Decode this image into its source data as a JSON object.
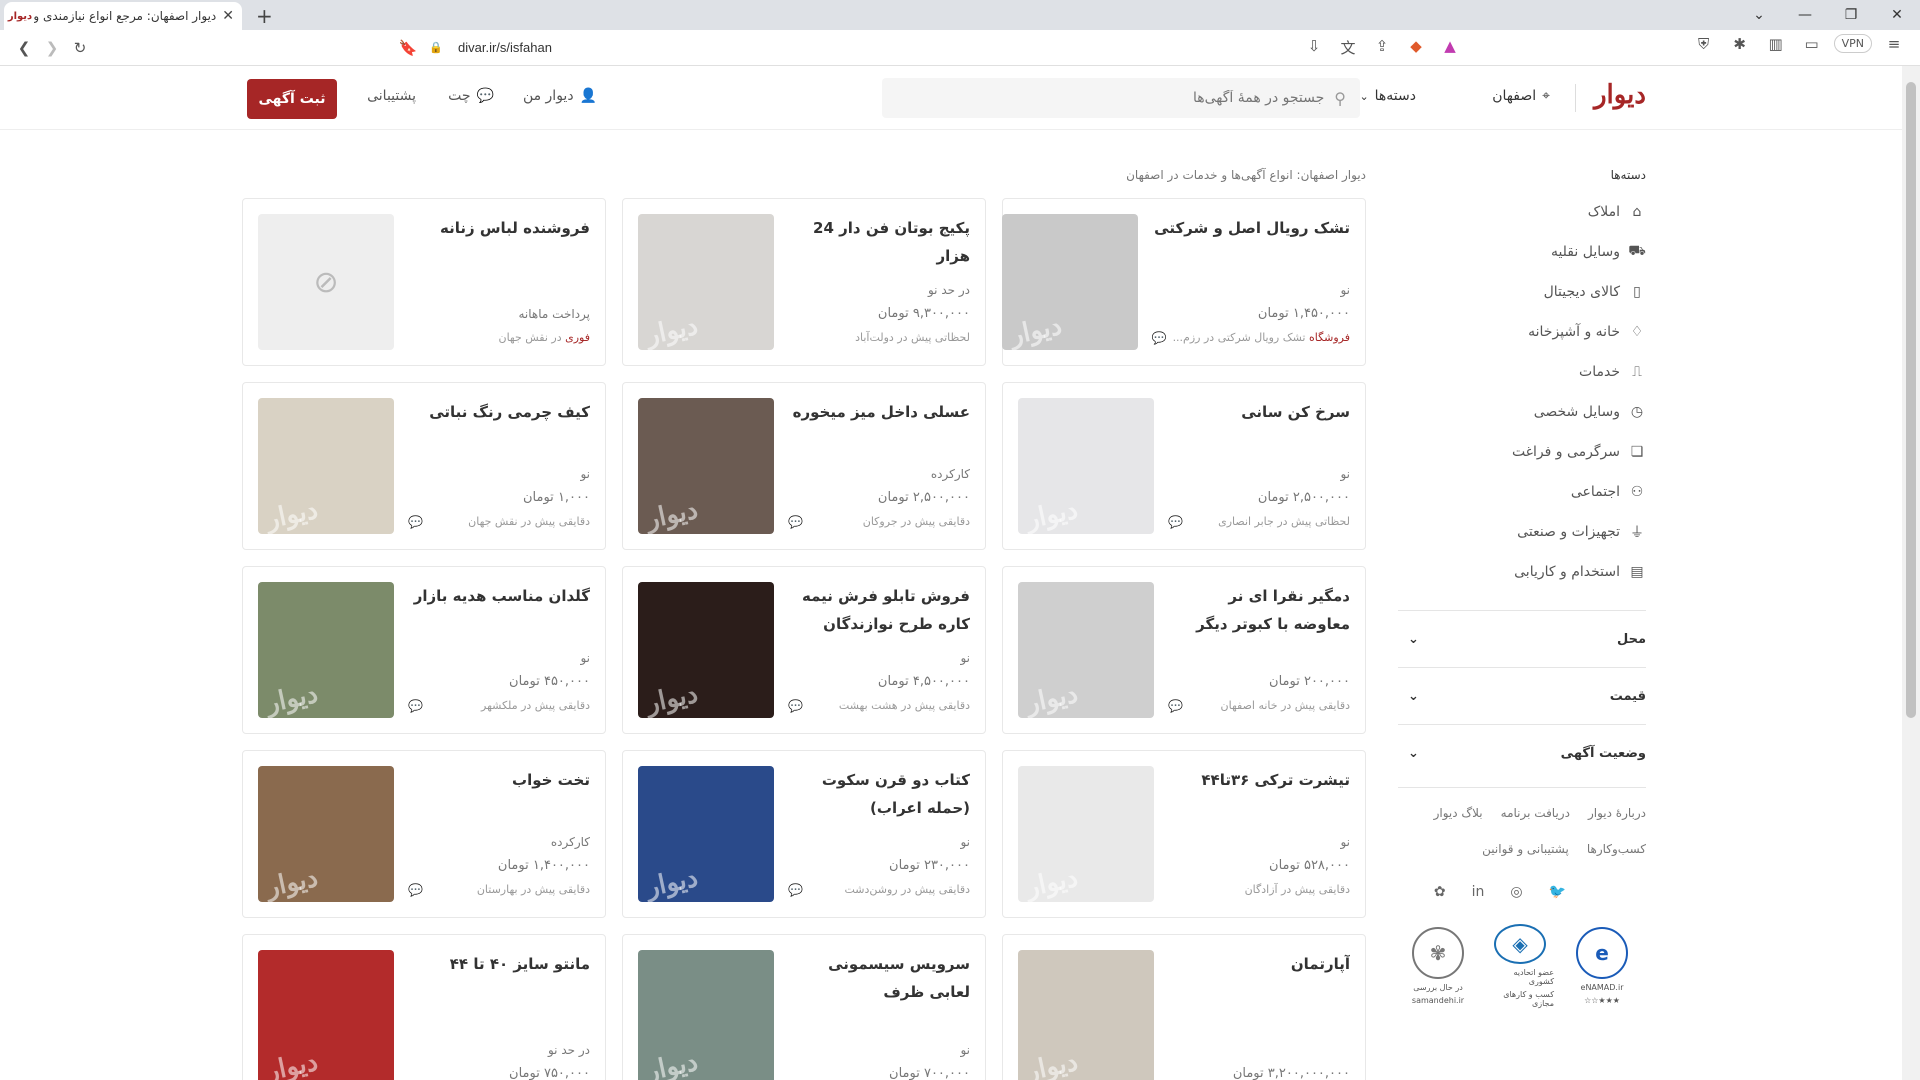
{
  "browser": {
    "tab_title": "دیوار اصفهان: مرجع انواع نیازمندی و",
    "tab_favicon": "دیوار",
    "url": "divar.ir/s/isfahan",
    "vpn_label": "VPN"
  },
  "header": {
    "logo": "دیوار",
    "city": "اصفهان",
    "categories_label": "دسته‌ها",
    "search_placeholder": "جستجو در همهٔ آگهی‌ها",
    "my_divar": "دیوار من",
    "chat": "چت",
    "support": "پشتیبانی",
    "post_ad": "ثبت آگهی"
  },
  "sidebar": {
    "title": "دسته‌ها",
    "items": [
      {
        "label": "املاک",
        "icon": "building-icon"
      },
      {
        "label": "وسایل نقلیه",
        "icon": "car-icon"
      },
      {
        "label": "کالای دیجیتال",
        "icon": "phone-icon"
      },
      {
        "label": "خانه و آشپزخانه",
        "icon": "lamp-icon"
      },
      {
        "label": "خدمات",
        "icon": "brush-icon"
      },
      {
        "label": "وسایل شخصی",
        "icon": "watch-icon"
      },
      {
        "label": "سرگرمی و فراغت",
        "icon": "puzzle-icon"
      },
      {
        "label": "اجتماعی",
        "icon": "people-icon"
      },
      {
        "label": "تجهیزات و صنعتی",
        "icon": "mic-icon"
      },
      {
        "label": "استخدام و کاریابی",
        "icon": "briefcase-icon"
      }
    ],
    "filters": [
      "محل",
      "قیمت",
      "وضعیت آگهی"
    ],
    "footer_links": [
      "دربارهٔ دیوار",
      "دریافت برنامه",
      "بلاگ دیوار",
      "کسب‌وکارها",
      "پشتیبانی و قوانین"
    ],
    "badges": [
      {
        "label": "eNAMAD.ir",
        "sub": "★★★☆☆"
      },
      {
        "label": "عضو اتحادیه کشوری",
        "sub": "کسب و کارهای مجازی"
      },
      {
        "label": "در حال بررسی",
        "sub": "samandehi.ir"
      }
    ]
  },
  "main": {
    "title": "دیوار اصفهان: انواع آگهی‌ها و خدمات در اصفهان",
    "cards": [
      {
        "title": "تشک رویال اصل و شرکتی",
        "meta": "نو",
        "price": "۱,۴۵۰,۰۰۰ تومان",
        "foot_prefix": "فروشگاه",
        "foot": "تشک رویال شرکتی در رزم...",
        "chat": true,
        "thumb": "#c9c9c9"
      },
      {
        "title": "پکیج بوتان فن دار 24 هزار",
        "meta": "در حد نو",
        "price": "۹,۳۰۰,۰۰۰ تومان",
        "foot_prefix": "",
        "foot": "لحظاتی پیش در دولت‌آباد",
        "chat": false,
        "thumb": "#d8d6d3"
      },
      {
        "title": "فروشنده لباس زنانه",
        "meta": "پرداخت ماهانه",
        "price": "",
        "foot_prefix": "فوری",
        "foot": "در نقش جهان",
        "chat": false,
        "thumb": "#eeeeee",
        "no_image": true
      },
      {
        "title": "سرخ کن سانی",
        "meta": "نو",
        "price": "۲,۵۰۰,۰۰۰ تومان",
        "foot_prefix": "",
        "foot": "لحظاتی پیش در جابر انصاری",
        "chat": true,
        "thumb": "#e6e6e8"
      },
      {
        "title": "عسلی داخل میز میخوره",
        "meta": "کارکرده",
        "price": "۲,۵۰۰,۰۰۰ تومان",
        "foot_prefix": "",
        "foot": "دقایقی پیش در جروکان",
        "chat": true,
        "thumb": "#6b5b52"
      },
      {
        "title": "کیف چرمی رنگ نباتی",
        "meta": "نو",
        "price": "۱,۰۰۰ تومان",
        "foot_prefix": "",
        "foot": "دقایقی پیش در نقش جهان",
        "chat": true,
        "thumb": "#d9d2c4"
      },
      {
        "title": "دمگیر نقرا ای نر معاوضه با کبوتر دیگر",
        "meta": "",
        "price": "۲۰۰,۰۰۰ تومان",
        "foot_prefix": "",
        "foot": "دقایقی پیش در خانه اصفهان",
        "chat": true,
        "thumb": "#cfcfcf"
      },
      {
        "title": "فروش تابلو فرش نیمه کاره طرح نوازندگان اصل تبریز",
        "meta": "نو",
        "price": "۴,۵۰۰,۰۰۰ تومان",
        "foot_prefix": "",
        "foot": "دقایقی پیش در هشت بهشت",
        "chat": true,
        "thumb": "#2b1d1a"
      },
      {
        "title": "گلدان مناسب هدیه بازار",
        "meta": "نو",
        "price": "۴۵۰,۰۰۰ تومان",
        "foot_prefix": "",
        "foot": "دقایقی پیش در ملکشهر",
        "chat": true,
        "thumb": "#7c8b6a"
      },
      {
        "title": "تیشرت ترکی ۳۶تا۴۴",
        "meta": "نو",
        "price": "۵۲۸,۰۰۰ تومان",
        "foot_prefix": "",
        "foot": "دقایقی پیش در آزادگان",
        "chat": false,
        "thumb": "#e9e9e9"
      },
      {
        "title": "کتاب دو قرن سکوت (حمله اعراب)",
        "meta": "نو",
        "price": "۲۳۰,۰۰۰ تومان",
        "foot_prefix": "",
        "foot": "دقایقی پیش در روشن‌دشت",
        "chat": true,
        "thumb": "#2a4a8a"
      },
      {
        "title": "تخت خواب",
        "meta": "کارکرده",
        "price": "۱,۴۰۰,۰۰۰ تومان",
        "foot_prefix": "",
        "foot": "دقایقی پیش در بهارستان",
        "chat": true,
        "thumb": "#8a6a4e"
      },
      {
        "title": "آپارتمان",
        "meta": "",
        "price": "۳,۲۰۰,۰۰۰,۰۰۰ تومان",
        "foot_prefix": "",
        "foot": "",
        "chat": false,
        "thumb": "#cfc8bd"
      },
      {
        "title": "سرویس سیسمونی لعابی ظرف",
        "meta": "نو",
        "price": "۷۰۰,۰۰۰ تومان",
        "foot_prefix": "",
        "foot": "",
        "chat": false,
        "thumb": "#7a8e86"
      },
      {
        "title": "مانتو سایز ۴۰ تا ۴۴",
        "meta": "در حد نو",
        "price": "۷۵۰,۰۰۰ تومان",
        "foot_prefix": "",
        "foot": "",
        "chat": false,
        "thumb": "#b32b2b"
      }
    ]
  },
  "watermark": "دیوار"
}
